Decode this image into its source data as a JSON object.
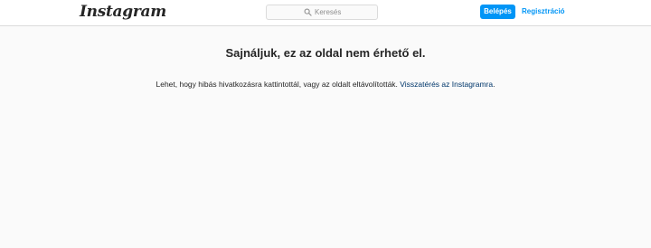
{
  "header": {
    "logo_text": "Instagram",
    "search": {
      "placeholder": "Keresés",
      "value": ""
    },
    "login_label": "Belépés",
    "signup_label": "Regisztráció"
  },
  "main": {
    "title": "Sajnáljuk, ez az oldal nem érhető el.",
    "message_text": "Lehet, hogy hibás hivatkozásra kattintottál, vagy az oldalt eltávolították. ",
    "back_link_label": "Visszatérés az Instagramra",
    "message_end": "."
  },
  "colors": {
    "accent": "#0095f6",
    "link": "#00376b",
    "background": "#fafafa",
    "text": "#262626"
  },
  "icons": [
    "search-icon"
  ]
}
